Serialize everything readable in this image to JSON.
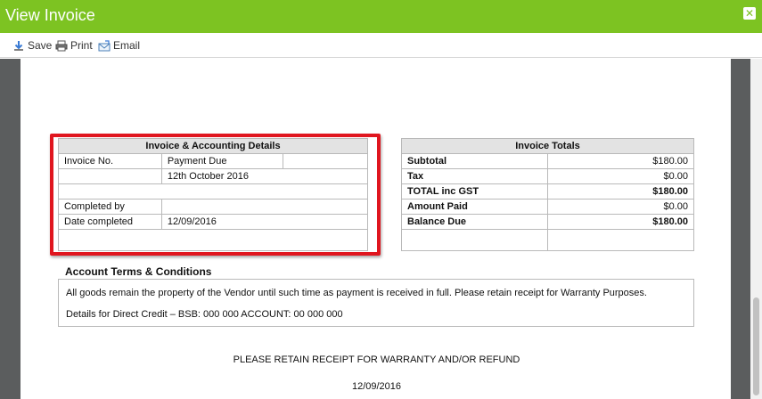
{
  "window": {
    "title": "View Invoice",
    "close_icon": "close-icon"
  },
  "toolbar": {
    "save_label": "Save",
    "print_label": "Print",
    "email_label": "Email"
  },
  "accounting": {
    "title": "Invoice & Accounting Details",
    "invoice_no_label": "Invoice No.",
    "payment_due_label": "Payment Due",
    "payment_due_value": "12th October 2016",
    "completed_by_label": "Completed by",
    "date_completed_label": "Date completed",
    "date_completed_value": "12/09/2016"
  },
  "totals": {
    "title": "Invoice Totals",
    "rows": [
      {
        "label": "Subtotal",
        "value": "$180.00",
        "bold": false
      },
      {
        "label": "Tax",
        "value": "$0.00",
        "bold": false
      },
      {
        "label": "TOTAL inc GST",
        "value": "$180.00",
        "bold": true
      },
      {
        "label": "Amount Paid",
        "value": "$0.00",
        "bold": false
      },
      {
        "label": "Balance Due",
        "value": "$180.00",
        "bold": true
      }
    ]
  },
  "terms": {
    "title": "Account Terms & Conditions",
    "line1": "All goods remain the property of the Vendor until such time as payment is received in full. Please retain receipt for Warranty Purposes.",
    "line2": "Details for Direct Credit – BSB: 000 000 ACCOUNT: 00 000 000"
  },
  "footer": {
    "note": "PLEASE RETAIN RECEIPT FOR WARRANTY AND/OR REFUND",
    "date": "12/09/2016"
  },
  "colors": {
    "titlebar": "#7dc322",
    "highlight": "#e0161f",
    "viewer_bg": "#5b5d5e"
  }
}
